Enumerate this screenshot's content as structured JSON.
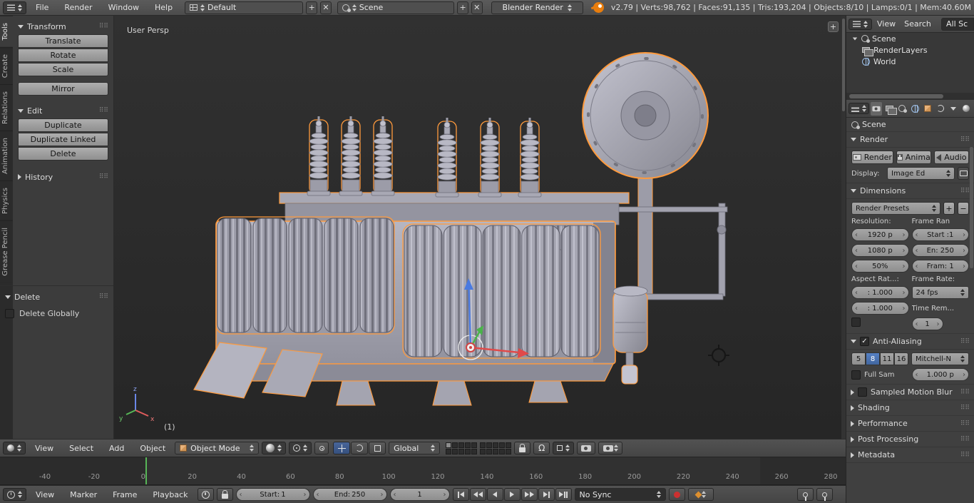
{
  "icons": {
    "close": "✕",
    "add": "+",
    "remove": "−",
    "magnet": "Ω",
    "expand": "+"
  },
  "topbar": {
    "menus": [
      "File",
      "Render",
      "Window",
      "Help"
    ],
    "layout": {
      "value": "Default"
    },
    "scene": {
      "value": "Scene"
    },
    "engine": {
      "value": "Blender Render"
    },
    "stats": {
      "text": "v2.79 | Verts:98,762 | Faces:91,135 | Tris:193,204 | Objects:8/10 | Lamps:0/1 | Mem:40.60M"
    }
  },
  "toolshelf": {
    "tabs": [
      "Tools",
      "Create",
      "Relations",
      "Animation",
      "Physics",
      "Grease Pencil"
    ],
    "transform": {
      "title": "Transform",
      "translate": "Translate",
      "rotate": "Rotate",
      "scale": "Scale",
      "mirror": "Mirror"
    },
    "edit": {
      "title": "Edit",
      "duplicate": "Duplicate",
      "duplicate_linked": "Duplicate Linked",
      "delete": "Delete"
    },
    "history": {
      "title": "History"
    },
    "operator": {
      "title": "Delete",
      "option": "Delete Globally"
    }
  },
  "viewport": {
    "view_label": "User Persp",
    "layer_label": "(1)",
    "axis": {
      "x": "x",
      "y": "y",
      "z": "z"
    }
  },
  "view3d_header": {
    "menus": [
      "View",
      "Select",
      "Add",
      "Object"
    ],
    "mode": "Object Mode",
    "orientation": "Global"
  },
  "timeline": {
    "ruler_ticks": [
      "-40",
      "-20",
      "0",
      "20",
      "40",
      "60",
      "80",
      "100",
      "120",
      "140",
      "160",
      "180",
      "200",
      "220",
      "240",
      "260",
      "280"
    ],
    "menus": [
      "View",
      "Marker",
      "Frame",
      "Playback"
    ],
    "start_label": "Start:",
    "start_value": "1",
    "end_label": "End:",
    "end_value": "250",
    "current_frame": "1",
    "sync": "No Sync"
  },
  "outliner": {
    "view": "View",
    "search": "Search",
    "filter": "All Sc",
    "items": [
      {
        "label": "Scene"
      },
      {
        "label": "RenderLayers"
      },
      {
        "label": "World"
      }
    ]
  },
  "properties": {
    "breadcrumb": "Scene",
    "render": {
      "title": "Render",
      "render_btn": "Render",
      "anim_btn": "Anima",
      "audio_btn": "Audio",
      "display_label": "Display:",
      "display_value": "Image Ed"
    },
    "dimensions": {
      "title": "Dimensions",
      "presets": "Render Presets",
      "resolution_label": "Resolution:",
      "frame_range_label": "Frame Ran",
      "res_x": "1920 p",
      "res_y": "1080 p",
      "res_pct": "50%",
      "frame_start": "Start :1",
      "frame_end": "En: 250",
      "frame_step": "Fram: 1",
      "aspect_label": "Aspect Rat...:",
      "rate_label": "Frame Rate:",
      "aspect_x": ": 1.000",
      "aspect_y": ": 1.000",
      "fps": "24 fps",
      "time_remap": "Time Rem...",
      "remap_value": "1"
    },
    "aa": {
      "title": "Anti-Aliasing",
      "s5": "5",
      "s8": "8",
      "s11": "11",
      "s16": "16",
      "filter": "Mitchell-N",
      "full_sample": "Full Sam",
      "size": "1.000 p"
    },
    "motion_blur": "Sampled Motion Blur",
    "shading": "Shading",
    "performance": "Performance",
    "post": "Post Processing",
    "metadata": "Metadata"
  }
}
